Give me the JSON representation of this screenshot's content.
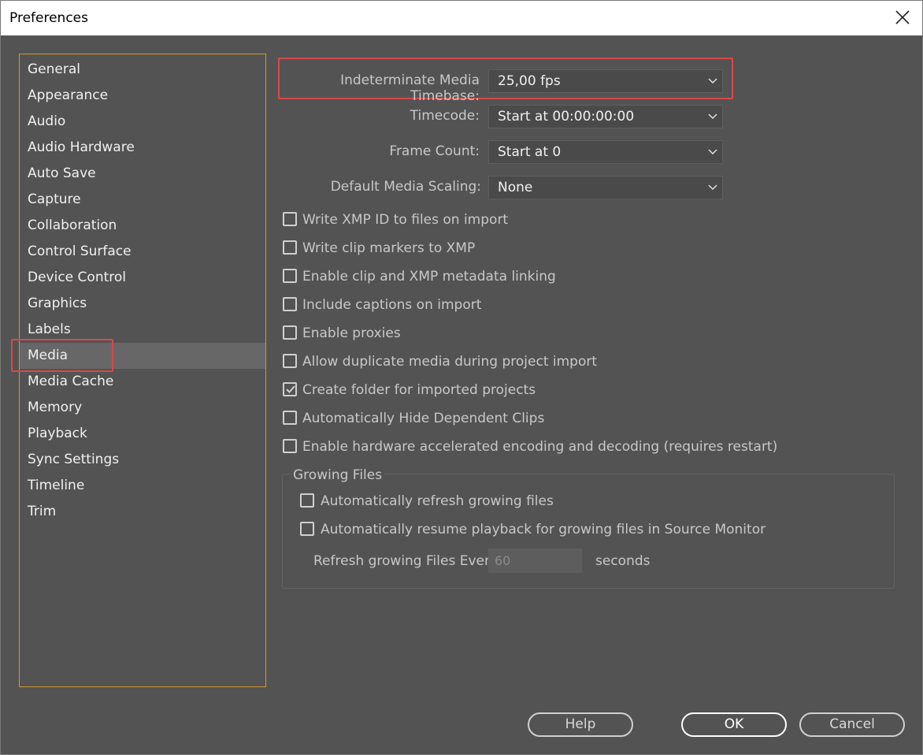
{
  "window": {
    "title": "Preferences"
  },
  "sidebar": {
    "items": [
      {
        "label": "General"
      },
      {
        "label": "Appearance"
      },
      {
        "label": "Audio"
      },
      {
        "label": "Audio Hardware"
      },
      {
        "label": "Auto Save"
      },
      {
        "label": "Capture"
      },
      {
        "label": "Collaboration"
      },
      {
        "label": "Control Surface"
      },
      {
        "label": "Device Control"
      },
      {
        "label": "Graphics"
      },
      {
        "label": "Labels"
      },
      {
        "label": "Media"
      },
      {
        "label": "Media Cache"
      },
      {
        "label": "Memory"
      },
      {
        "label": "Playback"
      },
      {
        "label": "Sync Settings"
      },
      {
        "label": "Timeline"
      },
      {
        "label": "Trim"
      }
    ],
    "selected": "Media"
  },
  "settings": {
    "timebase": {
      "label": "Indeterminate Media Timebase:",
      "value": "25,00 fps"
    },
    "timecode": {
      "label": "Timecode:",
      "value": "Start at 00:00:00:00"
    },
    "frame_count": {
      "label": "Frame Count:",
      "value": "Start at 0"
    },
    "scaling": {
      "label": "Default Media Scaling:",
      "value": "None"
    }
  },
  "checkboxes": [
    {
      "label": "Write XMP ID to files on import",
      "checked": false
    },
    {
      "label": "Write clip markers to XMP",
      "checked": false
    },
    {
      "label": "Enable clip and XMP metadata linking",
      "checked": false
    },
    {
      "label": "Include captions on import",
      "checked": false
    },
    {
      "label": "Enable proxies",
      "checked": false
    },
    {
      "label": "Allow duplicate media during project import",
      "checked": false
    },
    {
      "label": "Create folder for imported projects",
      "checked": true
    },
    {
      "label": "Automatically Hide Dependent Clips",
      "checked": false
    },
    {
      "label": "Enable hardware accelerated encoding and decoding (requires restart)",
      "checked": false
    }
  ],
  "growing_files": {
    "title": "Growing Files",
    "auto_refresh": {
      "label": "Automatically refresh growing files",
      "checked": false
    },
    "auto_resume": {
      "label": "Automatically resume playback for growing files in Source Monitor",
      "checked": false
    },
    "refresh_label": "Refresh growing Files Every",
    "refresh_value": "60",
    "refresh_unit": "seconds"
  },
  "buttons": {
    "help": "Help",
    "ok": "OK",
    "cancel": "Cancel"
  }
}
